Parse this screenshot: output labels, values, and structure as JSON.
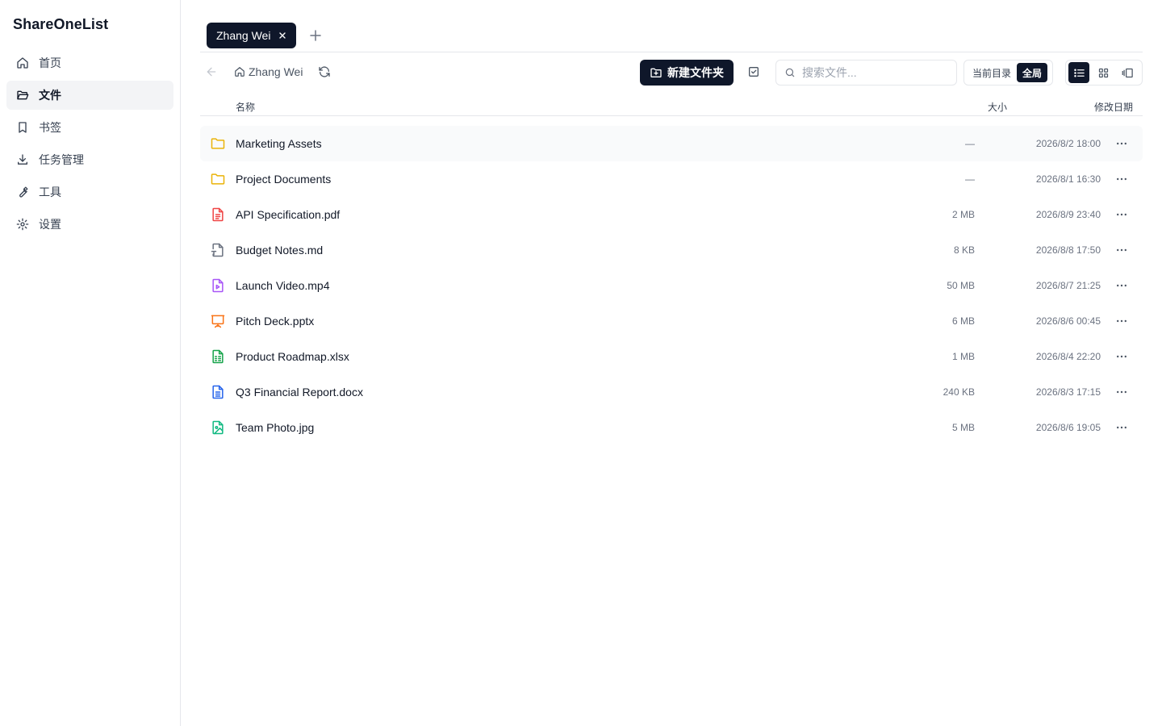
{
  "app": {
    "title": "ShareOneList"
  },
  "sidebar": {
    "items": [
      {
        "label": "首页",
        "icon": "home-icon",
        "active": false
      },
      {
        "label": "文件",
        "icon": "folder-open-icon",
        "active": true
      },
      {
        "label": "书签",
        "icon": "bookmark-icon",
        "active": false
      },
      {
        "label": "任务管理",
        "icon": "download-icon",
        "active": false
      },
      {
        "label": "工具",
        "icon": "wrench-icon",
        "active": false
      },
      {
        "label": "设置",
        "icon": "gear-icon",
        "active": false
      }
    ]
  },
  "tabs": [
    {
      "label": "Zhang Wei",
      "active": true
    }
  ],
  "toolbar": {
    "breadcrumb_root": "Zhang Wei",
    "new_folder_label": "新建文件夹",
    "search_placeholder": "搜索文件...",
    "scope_current": "当前目录",
    "scope_global": "全局",
    "scope_active": "全局",
    "view_active": "list"
  },
  "table": {
    "col_name": "名称",
    "col_size": "大小",
    "col_date": "修改日期",
    "rows": [
      {
        "name": "Marketing Assets",
        "size": "—",
        "date": "2026/8/2 18:00",
        "type": "folder"
      },
      {
        "name": "Project Documents",
        "size": "—",
        "date": "2026/8/1 16:30",
        "type": "folder"
      },
      {
        "name": "API Specification.pdf",
        "size": "2 MB",
        "date": "2026/8/9 23:40",
        "type": "pdf"
      },
      {
        "name": "Budget Notes.md",
        "size": "8 KB",
        "date": "2026/8/8 17:50",
        "type": "md"
      },
      {
        "name": "Launch Video.mp4",
        "size": "50 MB",
        "date": "2026/8/7 21:25",
        "type": "video"
      },
      {
        "name": "Pitch Deck.pptx",
        "size": "6 MB",
        "date": "2026/8/6 00:45",
        "type": "pptx"
      },
      {
        "name": "Product Roadmap.xlsx",
        "size": "1 MB",
        "date": "2026/8/4 22:20",
        "type": "xlsx"
      },
      {
        "name": "Q3 Financial Report.docx",
        "size": "240 KB",
        "date": "2026/8/3 17:15",
        "type": "docx"
      },
      {
        "name": "Team Photo.jpg",
        "size": "5 MB",
        "date": "2026/8/6 19:05",
        "type": "image"
      }
    ]
  },
  "colors": {
    "primary": "#0f172a",
    "folder": "#eab308",
    "pdf": "#ef4444",
    "md": "#6b7280",
    "video": "#a855f7",
    "pptx": "#f97316",
    "xlsx": "#16a34a",
    "docx": "#2563eb",
    "image": "#10b981"
  }
}
